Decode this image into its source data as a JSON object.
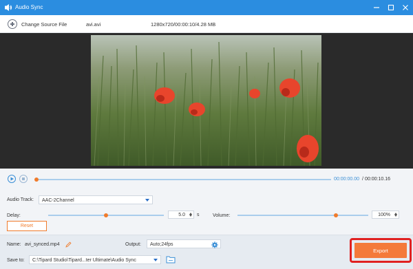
{
  "window": {
    "title": "Audio Sync",
    "accent": "#2b8de0"
  },
  "source": {
    "change_label": "Change Source File",
    "file_name": "avi.avi",
    "file_info": "1280x720/00:00:10/4.28 MB"
  },
  "player": {
    "current_time": "00:00:00.00",
    "total_time": "00:00:10.16",
    "progress": 0.0
  },
  "audio_track": {
    "label": "Audio Track:",
    "value": "AAC-2Channel"
  },
  "delay": {
    "label": "Delay:",
    "value": "5.0",
    "unit": "s",
    "level": 0.5
  },
  "volume": {
    "label": "Volume:",
    "value": "100%",
    "level": 0.75
  },
  "reset_label": "Reset",
  "output_file": {
    "name_label": "Name:",
    "name_value": "avi_synced.mp4",
    "output_label": "Output:",
    "output_value": "Auto;24fps"
  },
  "save": {
    "label": "Save to:",
    "path": "C:\\Tipard Studio\\Tipard...ter Ultimate\\Audio Sync"
  },
  "export_label": "Export",
  "colors": {
    "export": "#f47a3a",
    "highlight": "#e02020",
    "slider_thumb": "#f07b2b"
  }
}
